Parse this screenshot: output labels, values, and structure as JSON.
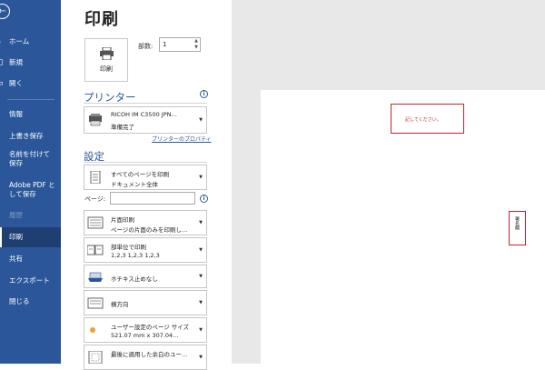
{
  "nav": {
    "back_icon": "back-arrow-icon",
    "items": [
      {
        "label": "ホーム",
        "icon": "home-icon"
      },
      {
        "label": "新規",
        "icon": "new-icon"
      },
      {
        "label": "開く",
        "icon": "open-icon"
      },
      {
        "label": "情報"
      },
      {
        "label": "上書き保存"
      },
      {
        "label": "名前を付けて保存"
      },
      {
        "label": "Adobe PDF として保存"
      },
      {
        "label": "履歴"
      },
      {
        "label": "印刷"
      },
      {
        "label": "共有"
      },
      {
        "label": "エクスポート"
      },
      {
        "label": "閉じる"
      }
    ]
  },
  "page_title": "印刷",
  "print_button_label": "印刷",
  "copies": {
    "label": "部数:",
    "value": "1"
  },
  "printer": {
    "section_label": "プリンター",
    "name": "RICOH IM C3500 JPN…",
    "status": "準備完了",
    "properties_link": "プリンターのプロパティ"
  },
  "settings": {
    "section_label": "設定",
    "pages_label": "ページ:",
    "items": [
      {
        "line1": "すべてのページを印刷",
        "line2": "ドキュメント全体",
        "icon": "pages-icon"
      },
      {
        "line1": "片面印刷",
        "line2": "ページの片面のみを印刷し…",
        "icon": "one-sided-icon"
      },
      {
        "line1": "部単位で印刷",
        "line2": "1,2,3    1,2,3    1,2,3",
        "icon": "collate-icon"
      },
      {
        "line1": "ホチキス止めなし",
        "line2": "",
        "icon": "staple-icon"
      },
      {
        "line1": "横方向",
        "line2": "",
        "icon": "orientation-icon"
      },
      {
        "line1": "ユーザー設定のページ サイズ",
        "line2": "521.07 mm x 307.04…",
        "icon": "page-size-icon"
      },
      {
        "line1": "最後に適用した余白のユー…",
        "line2": "",
        "icon": "margins-icon"
      }
    ]
  },
  "preview": {
    "text1": "記してください。",
    "text2": "署名欄"
  },
  "colors": {
    "nav": "#2b579a",
    "accent": "#2b579a",
    "annotation": "#c8232c"
  }
}
